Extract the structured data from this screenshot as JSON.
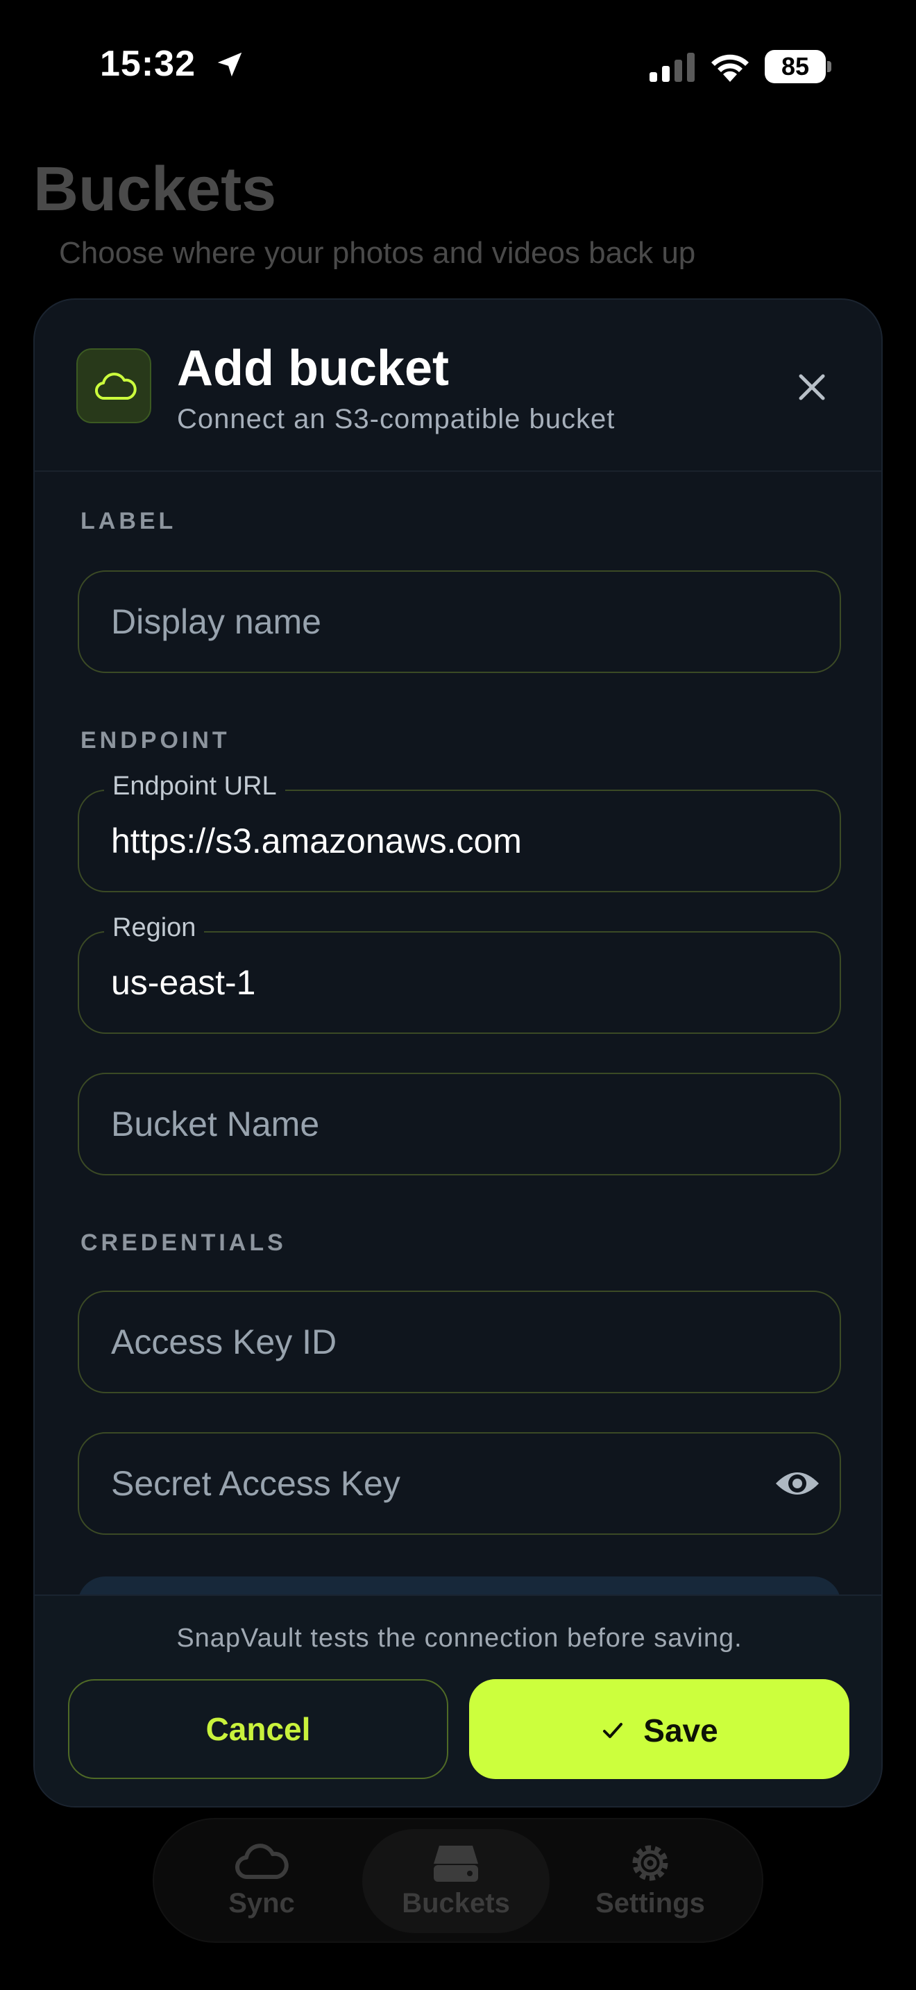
{
  "status_bar": {
    "time": "15:32",
    "battery": "85",
    "location_icon": "location-arrow-icon",
    "signal_icon": "cellular-signal-icon",
    "wifi_icon": "wifi-icon"
  },
  "page": {
    "title": "Buckets",
    "subtitle": "Choose where your photos and videos back up"
  },
  "sheet": {
    "icon": "cloud-icon",
    "title": "Add bucket",
    "subtitle": "Connect an S3-compatible bucket",
    "close_icon": "close-icon"
  },
  "sections": {
    "label": "LABEL",
    "endpoint": "ENDPOINT",
    "credentials": "CREDENTIALS"
  },
  "fields": {
    "display_name": {
      "placeholder": "Display name",
      "value": ""
    },
    "endpoint_url": {
      "label": "Endpoint URL",
      "value": "https://s3.amazonaws.com"
    },
    "region": {
      "label": "Region",
      "value": "us-east-1"
    },
    "bucket_name": {
      "placeholder": "Bucket Name",
      "value": ""
    },
    "access_key_id": {
      "placeholder": "Access Key ID",
      "value": ""
    },
    "secret_access_key": {
      "placeholder": "Secret Access Key",
      "value": "",
      "toggle_icon": "eye-icon"
    }
  },
  "footer": {
    "note": "SnapVault tests the connection before saving.",
    "cancel_label": "Cancel",
    "save_label": "Save",
    "save_icon": "checkmark-icon"
  },
  "tabbar": {
    "tabs": [
      {
        "label": "Sync",
        "icon": "cloud-icon",
        "active": false
      },
      {
        "label": "Buckets",
        "icon": "drive-icon",
        "active": true
      },
      {
        "label": "Settings",
        "icon": "gear-icon",
        "active": false
      }
    ]
  },
  "colors": {
    "accent": "#ccff3d",
    "sheet_bg": "#0f151d",
    "field_border": "#3b4a25"
  }
}
